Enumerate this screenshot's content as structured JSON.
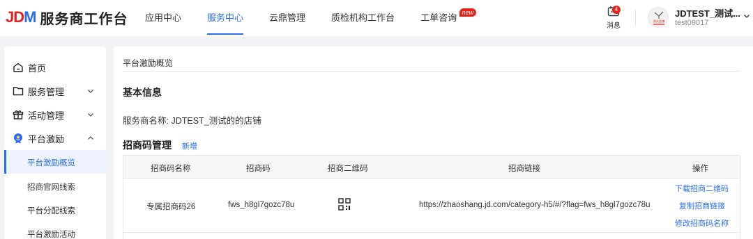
{
  "header": {
    "logo_mark": "JDM",
    "logo_mark_jd": "JD",
    "logo_mark_m": "M",
    "logo_title": "服务商工作台",
    "nav": [
      {
        "label": "应用中心",
        "active": false
      },
      {
        "label": "服务中心",
        "active": true
      },
      {
        "label": "云鼎管理",
        "active": false
      },
      {
        "label": "质检机构工作台",
        "active": false
      },
      {
        "label": "工单咨询",
        "active": false,
        "badge": "new"
      }
    ],
    "messages": {
      "count": "4",
      "label": "消息",
      "icon": "message-icon"
    },
    "user": {
      "name": "JDTEST_测试...",
      "id": "test09017",
      "avatar_text": "测试店铺"
    }
  },
  "sidebar": {
    "items": [
      {
        "label": "首页",
        "icon": "home-icon"
      },
      {
        "label": "服务管理",
        "icon": "folder-icon",
        "expanded": false
      },
      {
        "label": "活动管理",
        "icon": "gift-icon",
        "expanded": false
      },
      {
        "label": "平台激励",
        "icon": "medal-icon",
        "expanded": true
      }
    ],
    "subitems": [
      {
        "label": "平台激励概览",
        "active": true
      },
      {
        "label": "招商官网线索",
        "active": false
      },
      {
        "label": "平台分配线索",
        "active": false
      },
      {
        "label": "平台激励活动",
        "active": false
      }
    ]
  },
  "main": {
    "page_title": "平台激励概览",
    "basic_info": {
      "title": "基本信息",
      "provider_label": "服务商名称:",
      "provider_value": "JDTEST_测试的的店铺"
    },
    "codes": {
      "title": "招商码管理",
      "add_label": "新增",
      "columns": [
        "招商码名称",
        "招商码",
        "招商二维码",
        "招商链接",
        "操作"
      ],
      "rows": [
        {
          "name": "专属招商码26",
          "code": "fws_h8gl7gozc78u",
          "qr_icon": "qr-code-icon",
          "link": "https://zhaoshang.jd.com/category-h5/#/?flag=fws_h8gl7gozc78u",
          "actions": [
            "下载招商二维码",
            "复制招商链接",
            "修改招商码名称"
          ]
        }
      ]
    }
  },
  "colors": {
    "brand_red": "#e1251b",
    "accent_blue": "#2b6cf5"
  }
}
